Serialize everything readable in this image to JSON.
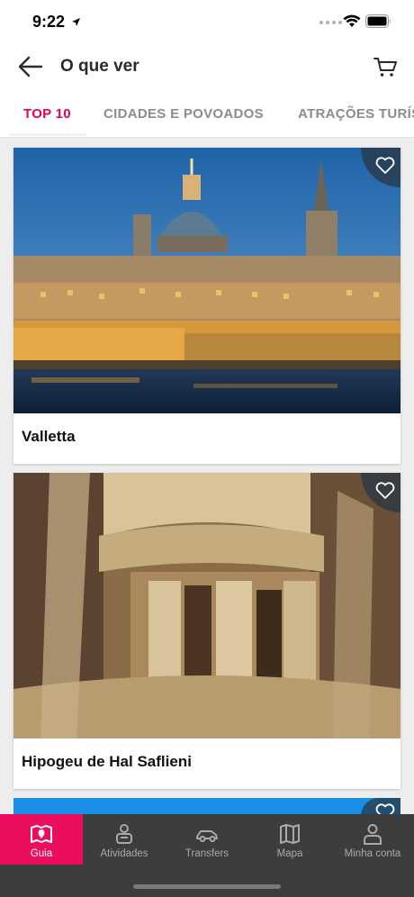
{
  "status_bar": {
    "time": "9:22"
  },
  "header": {
    "title": "O que ver"
  },
  "tabs": [
    {
      "label": "TOP 10"
    },
    {
      "label": "CIDADES E POVOADOS"
    },
    {
      "label": "ATRAÇÕES TURÍS"
    }
  ],
  "cards": [
    {
      "title": "Valletta",
      "image_icon": "valletta-photo"
    },
    {
      "title": "Hipogeu de Hal Saflieni",
      "image_icon": "hypogeum-photo"
    }
  ],
  "bottom_nav": [
    {
      "label": "Guia",
      "icon": "map-book-icon"
    },
    {
      "label": "Atividades",
      "icon": "activities-icon"
    },
    {
      "label": "Transfers",
      "icon": "car-icon"
    },
    {
      "label": "Mapa",
      "icon": "map-icon"
    },
    {
      "label": "Minha conta",
      "icon": "user-icon"
    }
  ],
  "colors": {
    "accent": "#e8005a",
    "nav_background": "#3d3d3d",
    "card_background": "#ffffff"
  }
}
